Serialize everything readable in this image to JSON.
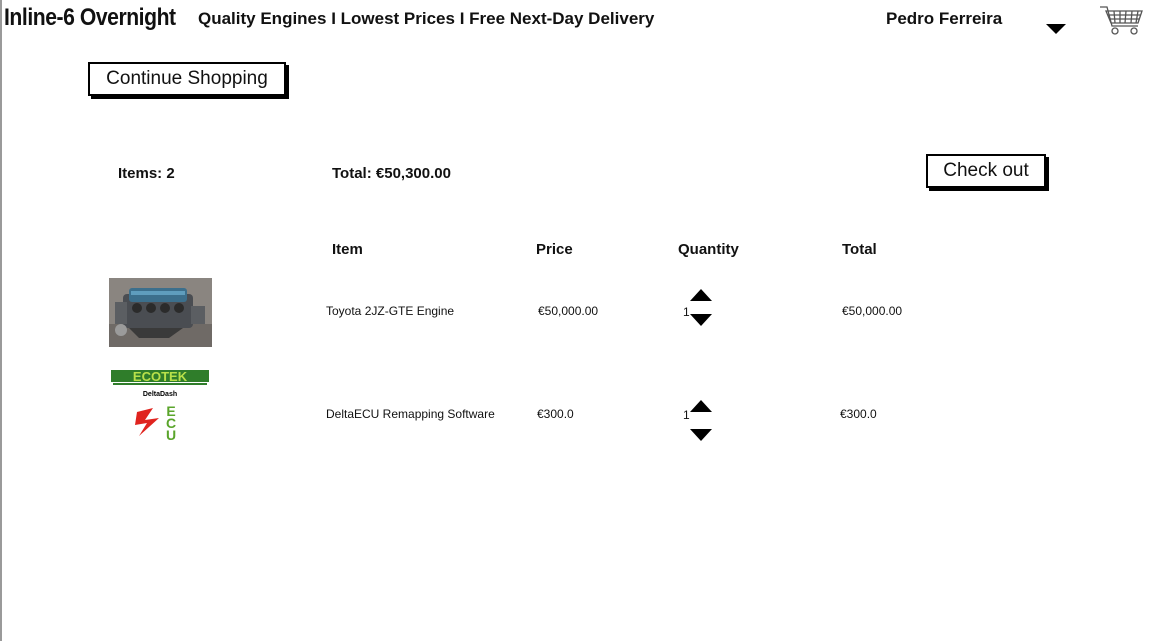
{
  "header": {
    "brand": "Inline-6 Overnight",
    "tagline": "Quality Engines I Lowest Prices I Free Next-Day Delivery",
    "user_name": "Pedro Ferreira"
  },
  "actions": {
    "continue_label": "Continue Shopping",
    "checkout_label": "Check out"
  },
  "summary": {
    "items_label": "Items: 2",
    "total_label": "Total: €50,300.00"
  },
  "table": {
    "headers": {
      "item": "Item",
      "price": "Price",
      "quantity": "Quantity",
      "total": "Total"
    },
    "rows": [
      {
        "name": "Toyota 2JZ-GTE Engine",
        "price": "€50,000.00",
        "quantity": "1",
        "total": "€50,000.00"
      },
      {
        "name": "DeltaECU Remapping Software",
        "price": "€300.0",
        "quantity": "1",
        "total": "€300.0"
      }
    ]
  },
  "ecu_logo": {
    "top_text": "ECOTEK",
    "sub_text": "DeltaDash",
    "mark_text": "ECU"
  },
  "icons": [
    "caret-down-icon",
    "shopping-cart-icon",
    "arrow-up-icon",
    "arrow-down-icon"
  ]
}
